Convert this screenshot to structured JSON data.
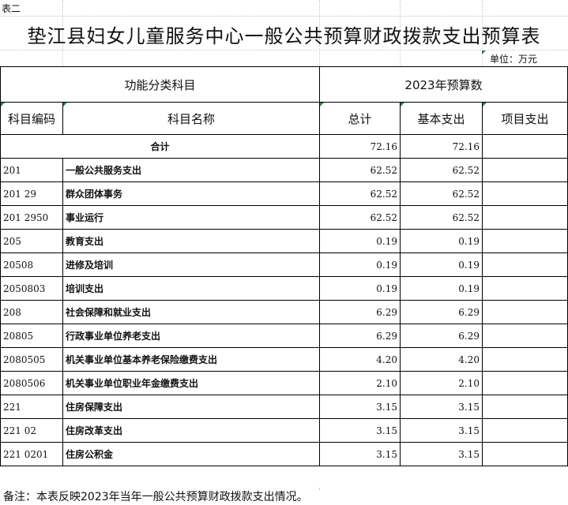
{
  "sheet_tag": "表二",
  "title": "垫江县妇女儿童服务中心一般公共预算财政拨款支出预算表",
  "unit": "单位：万元",
  "header": {
    "group_left": "功能分类科目",
    "group_right": "2023年预算数",
    "col_code": "科目编码",
    "col_name": "科目名称",
    "col_total": "总计",
    "col_basic": "基本支出",
    "col_project": "项目支出"
  },
  "rows": [
    {
      "code": "",
      "name": "合计",
      "total": "72.16",
      "basic": "72.16",
      "project": ""
    },
    {
      "code": "201",
      "name": "一般公共服务支出",
      "total": "62.52",
      "basic": "62.52",
      "project": ""
    },
    {
      "code": "201 29",
      "name": "群众团体事务",
      "total": "62.52",
      "basic": "62.52",
      "project": ""
    },
    {
      "code": "201 2950",
      "name": "事业运行",
      "total": "62.52",
      "basic": "62.52",
      "project": ""
    },
    {
      "code": "205",
      "name": "教育支出",
      "total": "0.19",
      "basic": "0.19",
      "project": ""
    },
    {
      "code": "20508",
      "name": "进修及培训",
      "total": "0.19",
      "basic": "0.19",
      "project": ""
    },
    {
      "code": "2050803",
      "name": "培训支出",
      "total": "0.19",
      "basic": "0.19",
      "project": ""
    },
    {
      "code": "208",
      "name": "社会保障和就业支出",
      "total": "6.29",
      "basic": "6.29",
      "project": ""
    },
    {
      "code": "20805",
      "name": "行政事业单位养老支出",
      "total": "6.29",
      "basic": "6.29",
      "project": ""
    },
    {
      "code": "2080505",
      "name": "机关事业单位基本养老保险缴费支出",
      "total": "4.20",
      "basic": "4.20",
      "project": ""
    },
    {
      "code": "2080506",
      "name": "机关事业单位职业年金缴费支出",
      "total": "2.10",
      "basic": "2.10",
      "project": ""
    },
    {
      "code": "221",
      "name": "住房保障支出",
      "total": "3.15",
      "basic": "3.15",
      "project": ""
    },
    {
      "code": "221 02",
      "name": "住房改革支出",
      "total": "3.15",
      "basic": "3.15",
      "project": ""
    },
    {
      "code": "221 0201",
      "name": "住房公积金",
      "total": "3.15",
      "basic": "3.15",
      "project": ""
    }
  ],
  "footnote": "备注：本表反映2023年当年一般公共预算财政拨款支出情况。",
  "colors": {
    "grid": "#000000",
    "marker": "#1f8a3c",
    "faint_grid": "#c8c8c8"
  }
}
